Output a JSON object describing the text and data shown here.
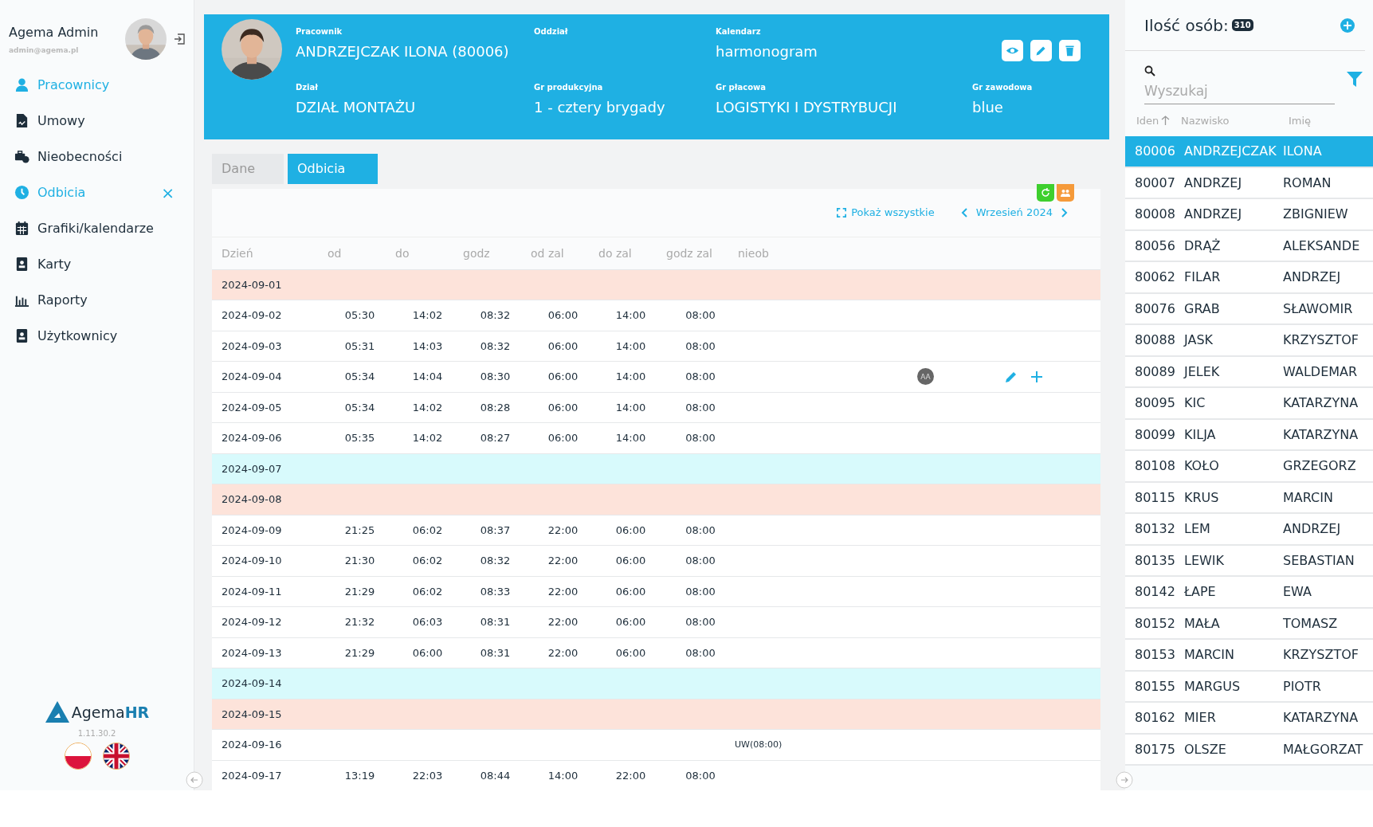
{
  "user": {
    "name": "Agema Admin",
    "email": "admin@agema.pl"
  },
  "nav": [
    {
      "label": "Pracownicy",
      "selected": true
    },
    {
      "label": "Umowy",
      "selected": false
    },
    {
      "label": "Nieobecności",
      "selected": false
    },
    {
      "label": "Odbicia",
      "selected": true,
      "close_glyph": "×"
    },
    {
      "label": "Grafiki/kalendarze",
      "selected": false
    },
    {
      "label": "Karty",
      "selected": false
    },
    {
      "label": "Raporty",
      "selected": false
    },
    {
      "label": "Użytkownicy",
      "selected": false
    }
  ],
  "brand": {
    "name": "Agema",
    "name_accent": "HR",
    "version": "1.11.30.2"
  },
  "employee": {
    "fields": [
      {
        "label": "Pracownik",
        "value": "ANDRZEJCZAK ILONA (80006)"
      },
      {
        "label": "Oddział"
      },
      {
        "label": "Kalendarz",
        "value": "harmonogram"
      },
      {
        "label": "Dział",
        "value": "DZIAŁ MONTAŻU"
      },
      {
        "label": "Gr produkcyjna",
        "value": "1 - cztery brygady"
      },
      {
        "label": "Gr płacowa",
        "value": "LOGISTYKI I DYSTRYBUCJI"
      },
      {
        "label": "Gr zawodowa",
        "value": "blue"
      }
    ]
  },
  "tabs": [
    {
      "label": "Dane",
      "selected": false
    },
    {
      "label": "Odbicia",
      "selected": true
    }
  ],
  "toolbar": {
    "show_all": "Pokaż wszystkie",
    "month": "Wrzesień 2024"
  },
  "table": {
    "columns": [
      "Dzień",
      "od",
      "do",
      "godz",
      "od zal",
      "do zal",
      "godz zal",
      "nieob"
    ],
    "rows": [
      {
        "kind": "sunday",
        "day": "2024-09-01",
        "actions": false
      },
      {
        "kind": "workday",
        "day": "2024-09-02",
        "cells": [
          "05:30",
          "14:02",
          "08:32",
          "06:00",
          "14:00",
          "08:00"
        ],
        "actions": false
      },
      {
        "kind": "workday",
        "day": "2024-09-03",
        "cells": [
          "05:31",
          "14:03",
          "08:32",
          "06:00",
          "14:00",
          "08:00"
        ],
        "actions": false
      },
      {
        "kind": "workday",
        "day": "2024-09-04",
        "cells": [
          "05:34",
          "14:04",
          "08:30",
          "06:00",
          "14:00",
          "08:00"
        ],
        "badge": "AA",
        "actions": true
      },
      {
        "kind": "workday",
        "day": "2024-09-05",
        "cells": [
          "05:34",
          "14:02",
          "08:28",
          "06:00",
          "14:00",
          "08:00"
        ],
        "actions": false
      },
      {
        "kind": "workday",
        "day": "2024-09-06",
        "cells": [
          "05:35",
          "14:02",
          "08:27",
          "06:00",
          "14:00",
          "08:00"
        ],
        "actions": false
      },
      {
        "kind": "saturday",
        "day": "2024-09-07",
        "actions": false
      },
      {
        "kind": "sunday",
        "day": "2024-09-08",
        "actions": false
      },
      {
        "kind": "workday",
        "day": "2024-09-09",
        "cells": [
          "21:25",
          "06:02",
          "08:37",
          "22:00",
          "06:00",
          "08:00"
        ],
        "actions": false
      },
      {
        "kind": "workday",
        "day": "2024-09-10",
        "cells": [
          "21:30",
          "06:02",
          "08:32",
          "22:00",
          "06:00",
          "08:00"
        ],
        "actions": false
      },
      {
        "kind": "workday",
        "day": "2024-09-11",
        "cells": [
          "21:29",
          "06:02",
          "08:33",
          "22:00",
          "06:00",
          "08:00"
        ],
        "actions": false
      },
      {
        "kind": "workday",
        "day": "2024-09-12",
        "cells": [
          "21:32",
          "06:03",
          "08:31",
          "22:00",
          "06:00",
          "08:00"
        ],
        "actions": false
      },
      {
        "kind": "workday",
        "day": "2024-09-13",
        "cells": [
          "21:29",
          "06:00",
          "08:31",
          "22:00",
          "06:00",
          "08:00"
        ],
        "actions": false
      },
      {
        "kind": "saturday",
        "day": "2024-09-14",
        "actions": false
      },
      {
        "kind": "sunday",
        "day": "2024-09-15",
        "actions": false
      },
      {
        "kind": "workday",
        "day": "2024-09-16",
        "nieob": "UW(08:00)",
        "actions": false
      },
      {
        "kind": "workday",
        "day": "2024-09-17",
        "cells": [
          "13:19",
          "22:03",
          "08:44",
          "14:00",
          "22:00",
          "08:00"
        ],
        "actions": false
      }
    ]
  },
  "people": {
    "title": "Ilość osób:",
    "count": "310",
    "search": {
      "placeholder": "Wyszukaj"
    },
    "columns": [
      {
        "label": "Iden",
        "sorted": true
      },
      {
        "label": "Nazwisko",
        "sorted": false
      },
      {
        "label": "Imię",
        "sorted": false
      }
    ],
    "rows": [
      {
        "id": "80006",
        "surname": "ANDRZEJCZAK",
        "name": "ILONA",
        "selected": true
      },
      {
        "id": "80007",
        "surname": "ANDRZEJ",
        "name": "ROMAN",
        "selected": false
      },
      {
        "id": "80008",
        "surname": "ANDRZEJ",
        "name": "ZBIGNIEW",
        "selected": false
      },
      {
        "id": "80056",
        "surname": "DRĄŻ",
        "name": "ALEKSANDE",
        "selected": false
      },
      {
        "id": "80062",
        "surname": "FILAR",
        "name": "ANDRZEJ",
        "selected": false
      },
      {
        "id": "80076",
        "surname": "GRAB",
        "name": "SŁAWOMIR",
        "selected": false
      },
      {
        "id": "80088",
        "surname": "JASK",
        "name": "KRZYSZTOF",
        "selected": false
      },
      {
        "id": "80089",
        "surname": "JELEK",
        "name": "WALDEMAR",
        "selected": false
      },
      {
        "id": "80095",
        "surname": "KIC",
        "name": "KATARZYNA",
        "selected": false
      },
      {
        "id": "80099",
        "surname": "KILJA",
        "name": "KATARZYNA",
        "selected": false
      },
      {
        "id": "80108",
        "surname": "KOŁO",
        "name": "GRZEGORZ",
        "selected": false
      },
      {
        "id": "80115",
        "surname": "KRUS",
        "name": "MARCIN",
        "selected": false
      },
      {
        "id": "80132",
        "surname": "LEM",
        "name": "ANDRZEJ",
        "selected": false
      },
      {
        "id": "80135",
        "surname": "LEWIK",
        "name": "SEBASTIAN",
        "selected": false
      },
      {
        "id": "80142",
        "surname": "ŁAPE",
        "name": "EWA",
        "selected": false
      },
      {
        "id": "80152",
        "surname": "MAŁA",
        "name": "TOMASZ",
        "selected": false
      },
      {
        "id": "80153",
        "surname": "MARCIN",
        "name": "KRZYSZTOF",
        "selected": false
      },
      {
        "id": "80155",
        "surname": "MARGUS",
        "name": "PIOTR",
        "selected": false
      },
      {
        "id": "80162",
        "surname": "MIER",
        "name": "KATARZYNA",
        "selected": false
      },
      {
        "id": "80175",
        "surname": "OLSZE",
        "name": "MAŁGORZAT",
        "selected": false
      }
    ]
  }
}
